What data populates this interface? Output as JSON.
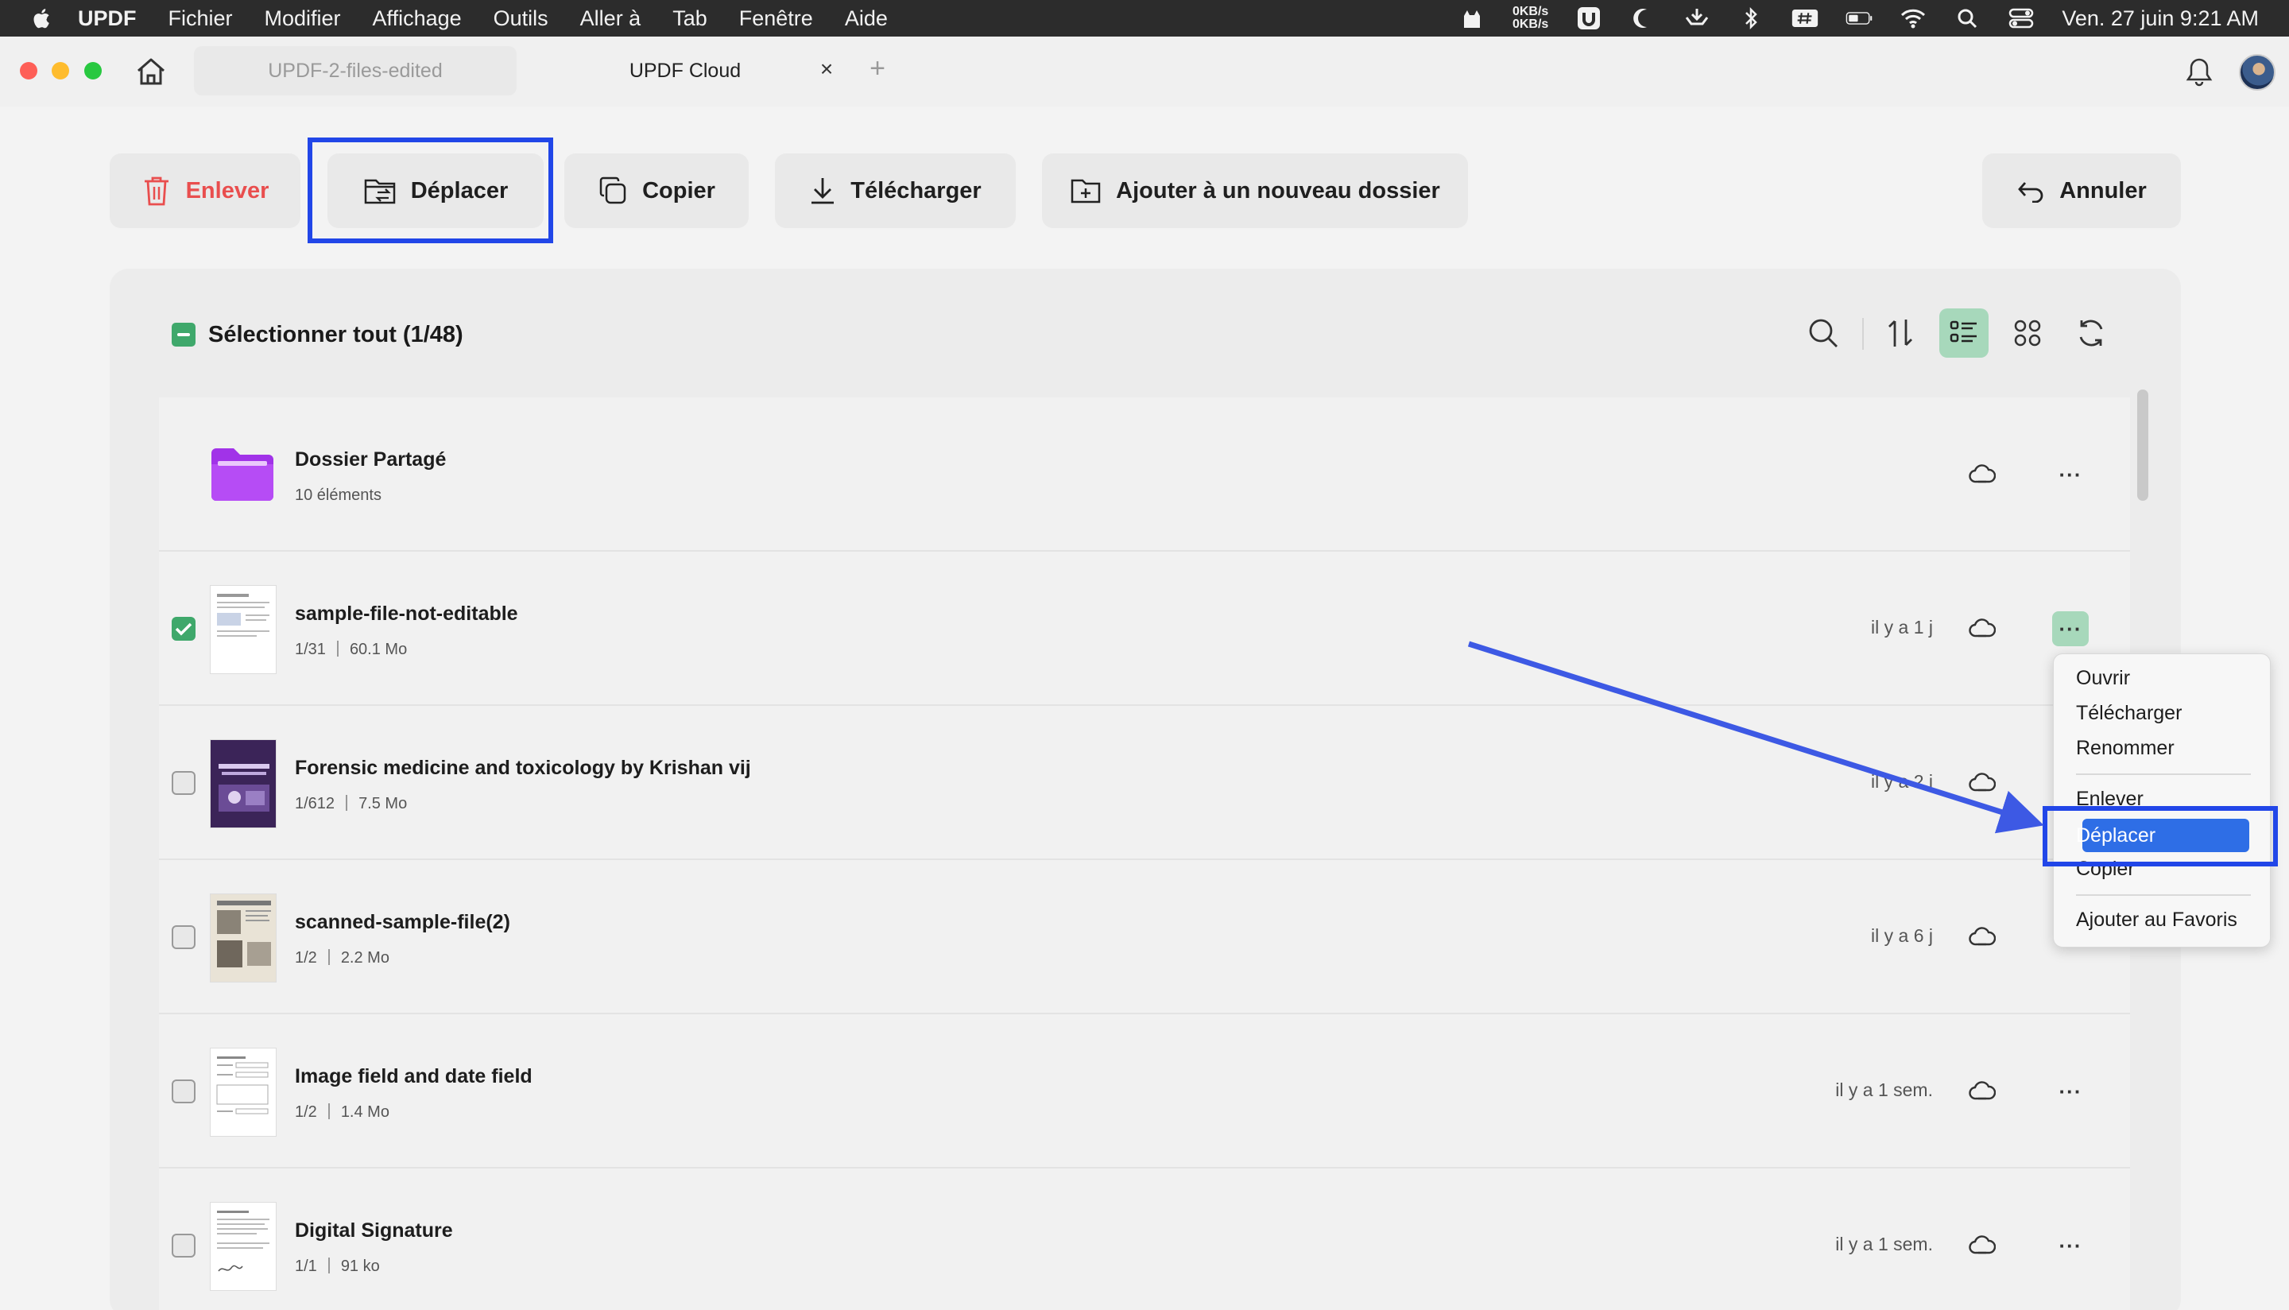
{
  "menubar": {
    "app": "UPDF",
    "items": [
      "Fichier",
      "Modifier",
      "Affichage",
      "Outils",
      "Aller à",
      "Tab",
      "Fenêtre",
      "Aide"
    ],
    "netspeed_up": "0KB/s",
    "netspeed_down": "0KB/s",
    "clock": "Ven. 27 juin  9:21 AM"
  },
  "tabs": {
    "tab1": "UPDF-2-files-edited",
    "tab2": "UPDF Cloud",
    "close": "×",
    "add": "+"
  },
  "toolbar": {
    "remove": "Enlever",
    "move": "Déplacer",
    "copy": "Copier",
    "download": "Télécharger",
    "new_folder": "Ajouter à un nouveau dossier",
    "cancel": "Annuler",
    "remove_color": "#e94e4e"
  },
  "panel": {
    "select_all": "Sélectionner tout (1/48)"
  },
  "rows": [
    {
      "name": "Dossier Partagé",
      "meta": "10 éléments",
      "time": "",
      "checked": false,
      "type": "folder"
    },
    {
      "name": "sample-file-not-editable",
      "pages": "1/31",
      "size": "60.1 Mo",
      "time": "il y a 1 j",
      "checked": true
    },
    {
      "name": "Forensic medicine and toxicology  by Krishan vij",
      "pages": "1/612",
      "size": "7.5 Mo",
      "time": "il y a 2 j",
      "checked": false
    },
    {
      "name": "scanned-sample-file(2)",
      "pages": "1/2",
      "size": "2.2 Mo",
      "time": "il y a 6 j",
      "checked": false
    },
    {
      "name": "Image field and date field",
      "pages": "1/2",
      "size": "1.4 Mo",
      "time": "il y a 1 sem.",
      "checked": false
    },
    {
      "name": "Digital Signature",
      "pages": "1/1",
      "size": "91 ko",
      "time": "il y a 1 sem.",
      "checked": false
    }
  ],
  "more_label": "···",
  "context_menu": {
    "open": "Ouvrir",
    "download": "Télécharger",
    "rename": "Renommer",
    "remove": "Enlever",
    "move": "Déplacer",
    "copy": "Copier",
    "favorite": "Ajouter au Favoris"
  },
  "colors": {
    "accent_green": "#3fa86b",
    "highlight_blue": "#2146e8",
    "menu_selection": "#2e6ee6"
  }
}
